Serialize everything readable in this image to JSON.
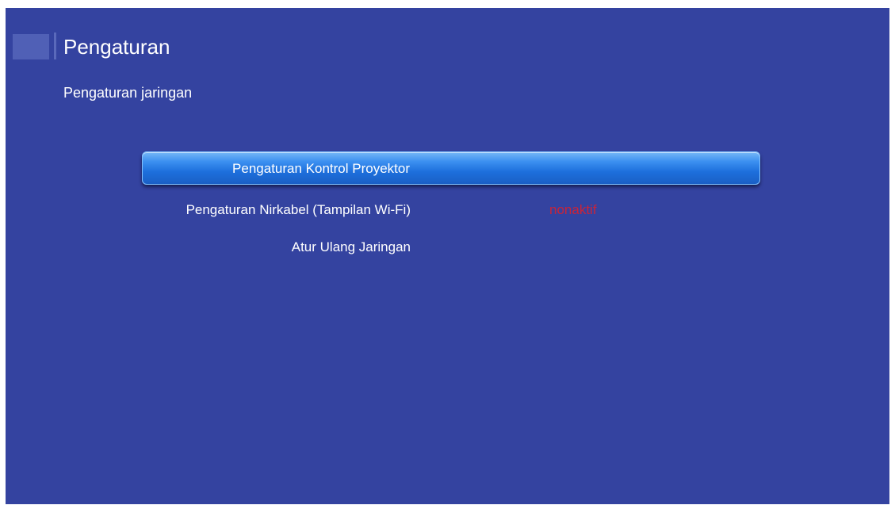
{
  "header": {
    "icon": "settings-category-icon",
    "title": "Pengaturan"
  },
  "subtitle": "Pengaturan jaringan",
  "menu": {
    "items": [
      {
        "label": "Pengaturan Kontrol Proyektor",
        "value": "",
        "selected": true
      },
      {
        "label": "Pengaturan Nirkabel (Tampilan Wi-Fi)",
        "value": "nonaktif",
        "selected": false
      },
      {
        "label": "Atur Ulang Jaringan",
        "value": "",
        "selected": false
      }
    ]
  },
  "colors": {
    "background": "#3443a0",
    "selected_highlight": "#2f84ea",
    "value_text": "#c8243a",
    "text": "#ffffff"
  }
}
